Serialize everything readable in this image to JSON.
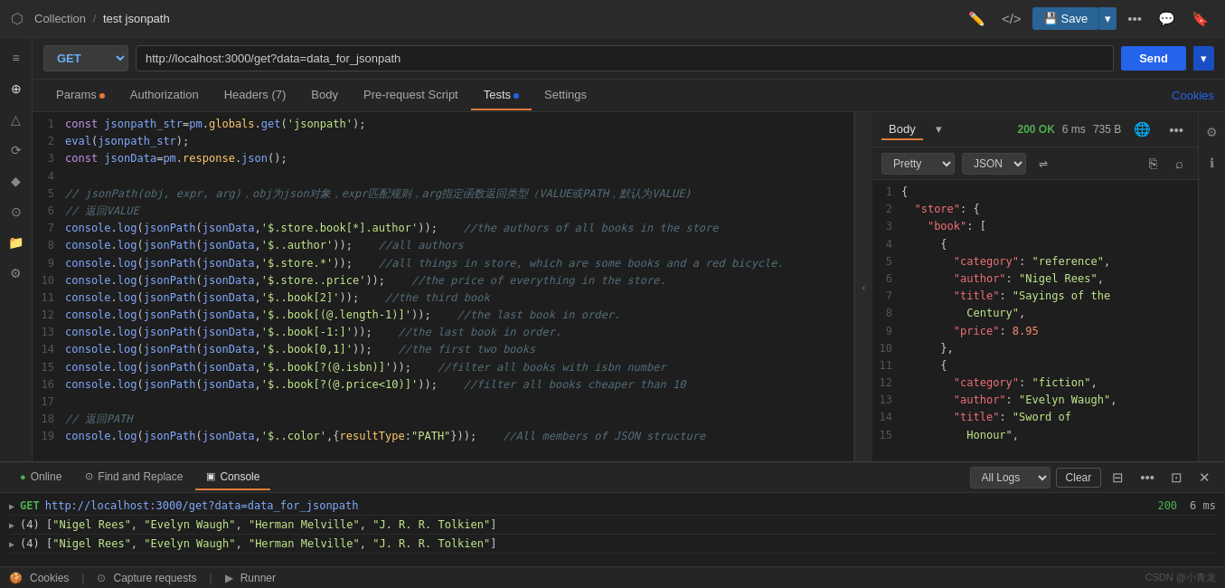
{
  "topbar": {
    "collection": "Collection",
    "separator": "/",
    "title": "test jsonpath",
    "save_label": "Save",
    "logo": "⬡"
  },
  "urlbar": {
    "method": "GET",
    "url": "http://localhost:3000/get?data=data_for_jsonpath",
    "send_label": "Send"
  },
  "tabs": {
    "items": [
      {
        "label": "Params",
        "dot": true,
        "active": false
      },
      {
        "label": "Authorization",
        "dot": false,
        "active": false
      },
      {
        "label": "Headers (7)",
        "dot": false,
        "active": false
      },
      {
        "label": "Body",
        "dot": false,
        "active": false
      },
      {
        "label": "Pre-request Script",
        "dot": false,
        "active": false
      },
      {
        "label": "Tests",
        "dot": true,
        "active": true
      },
      {
        "label": "Settings",
        "dot": false,
        "active": false
      }
    ],
    "cookies_label": "Cookies"
  },
  "editor": {
    "lines": [
      {
        "num": 1,
        "code": "const jsonpath_str=pm.globals.get('jsonpath');"
      },
      {
        "num": 2,
        "code": "eval(jsonpath_str);"
      },
      {
        "num": 3,
        "code": "const jsonData=pm.response.json();"
      },
      {
        "num": 4,
        "code": ""
      },
      {
        "num": 5,
        "code": "// jsonPath(obj, expr, arg)，obj为json对象，expr匹配规则，arg指定函数返回类型（VALUE或PATH，默认为VALUE)"
      },
      {
        "num": 6,
        "code": "// 返回VALUE"
      },
      {
        "num": 7,
        "code": "console.log(jsonPath(jsonData,'$.store.book[*].author'));    //the authors of all books in the store"
      },
      {
        "num": 8,
        "code": "console.log(jsonPath(jsonData,'$..author'));    //all authors"
      },
      {
        "num": 9,
        "code": "console.log(jsonPath(jsonData,'$.store.*'));    //all things in store, which are some books and a red bicycle."
      },
      {
        "num": 10,
        "code": "console.log(jsonPath(jsonData,'$.store..price'));    //the price of everything in the store."
      },
      {
        "num": 11,
        "code": "console.log(jsonPath(jsonData,'$..book[2]'));    //the third book"
      },
      {
        "num": 12,
        "code": "console.log(jsonPath(jsonData,'$..book[(@.length-1)]'));    //the last book in order."
      },
      {
        "num": 13,
        "code": "console.log(jsonPath(jsonData,'$..book[-1:]'));    //the last book in order."
      },
      {
        "num": 14,
        "code": "console.log(jsonPath(jsonData,'$..book[0,1]'));    //the first two books"
      },
      {
        "num": 15,
        "code": "console.log(jsonPath(jsonData,'$..book[?(@.isbn)]'));    //filter all books with isbn number"
      },
      {
        "num": 16,
        "code": "console.log(jsonPath(jsonData,'$..book[?(@.price<10)]'));    //filter all books cheaper than 10"
      },
      {
        "num": 17,
        "code": ""
      },
      {
        "num": 18,
        "code": "// 返回PATH"
      },
      {
        "num": 19,
        "code": "console.log(jsonPath(jsonData,'$..color',{resultType:\"PATH\"}));    //All members of JSON structure"
      }
    ]
  },
  "response": {
    "tabs": [
      {
        "label": "Body",
        "active": true
      },
      {
        "label": "▾",
        "active": false
      }
    ],
    "status": "200 OK",
    "time": "6 ms",
    "size": "735 B",
    "format": "Pretty",
    "format2": "JSON",
    "lines": [
      {
        "num": 1,
        "code": "{"
      },
      {
        "num": 2,
        "code": "  \"store\": {"
      },
      {
        "num": 3,
        "code": "    \"book\": ["
      },
      {
        "num": 4,
        "code": "      {"
      },
      {
        "num": 5,
        "code": "        \"category\": \"reference\","
      },
      {
        "num": 6,
        "code": "        \"author\": \"Nigel Rees\","
      },
      {
        "num": 7,
        "code": "        \"title\": \"Sayings of the"
      },
      {
        "num": 8,
        "code": "          Century\","
      },
      {
        "num": 9,
        "code": "        \"price\": 8.95"
      },
      {
        "num": 10,
        "code": "      },"
      },
      {
        "num": 11,
        "code": "      {"
      },
      {
        "num": 12,
        "code": "        \"category\": \"fiction\","
      },
      {
        "num": 13,
        "code": "        \"author\": \"Evelyn Waugh\","
      },
      {
        "num": 14,
        "code": "        \"title\": \"Sword of"
      },
      {
        "num": 15,
        "code": "          Honour\","
      }
    ]
  },
  "console": {
    "tabs": [
      {
        "label": "Online",
        "icon": "●",
        "active": false
      },
      {
        "label": "Find and Replace",
        "icon": "⊙",
        "active": false
      },
      {
        "label": "Console",
        "icon": "▣",
        "active": true
      }
    ],
    "all_logs_label": "All Logs",
    "clear_label": "Clear",
    "entries": [
      {
        "type": "request",
        "method": "GET",
        "url": "http://localhost:3000/get?data=data_for_jsonpath",
        "status": "200",
        "time": "6 ms"
      },
      {
        "type": "log",
        "content": "(4) [\"Nigel Rees\", \"Evelyn Waugh\", \"Herman Melville\", \"J. R. R. Tolkien\"]"
      },
      {
        "type": "log",
        "content": "(4) [\"Nigel Rees\", \"Evelyn Waugh\", \"Herman Melville\", \"J. R. R. Tolkien\"]"
      }
    ],
    "footer": {
      "cookies_label": "Cookies",
      "capture_label": "Capture requests",
      "runner_label": "Runner"
    }
  },
  "sidebar": {
    "icons": [
      "≡",
      "⊕",
      "△",
      "⟳",
      "♦",
      "⊙",
      "📁",
      "⊕",
      "☰"
    ]
  }
}
